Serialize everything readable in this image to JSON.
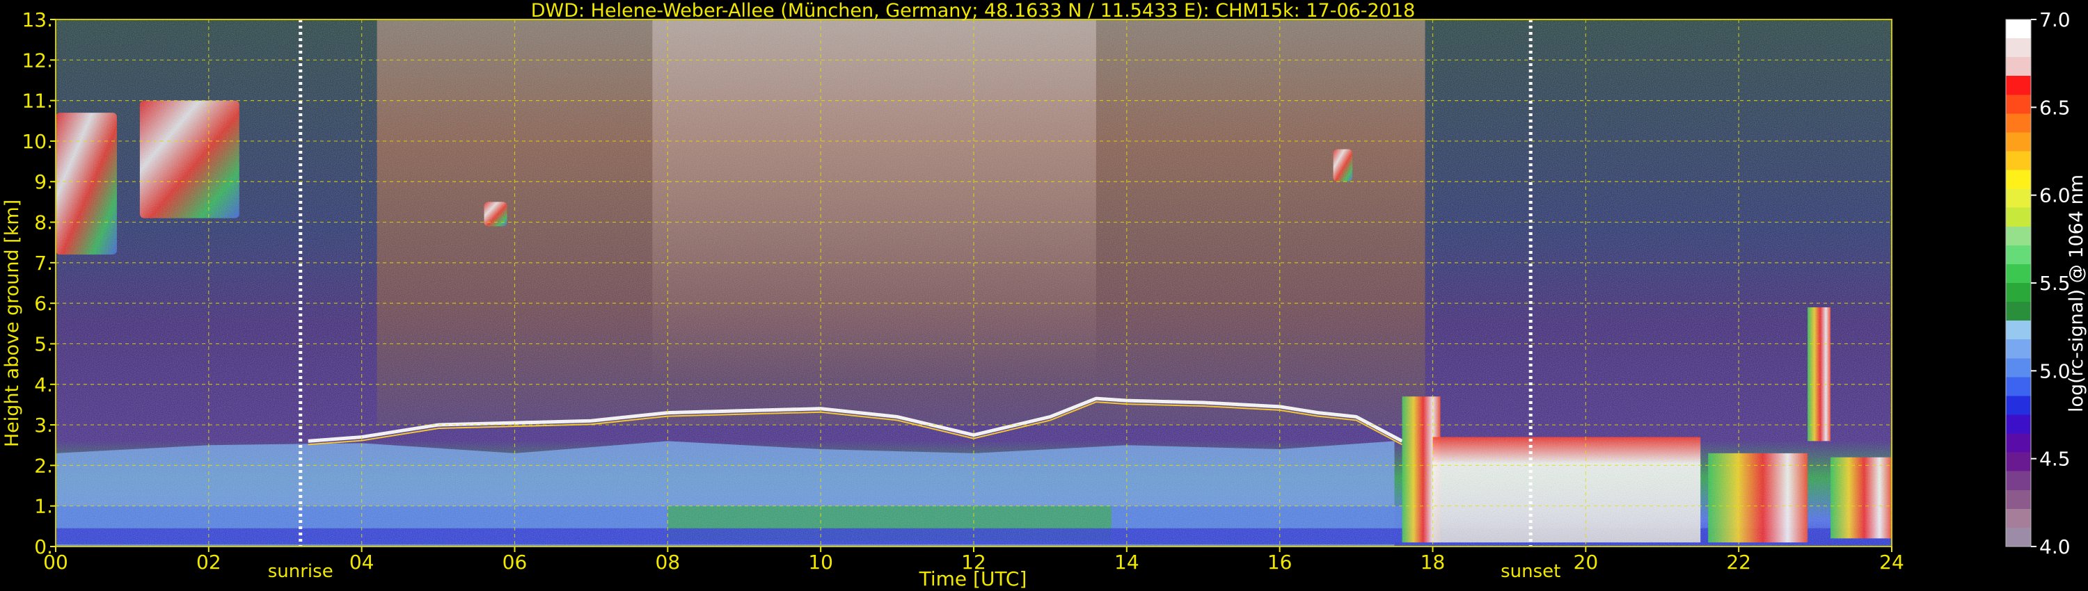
{
  "chart_data": {
    "type": "heatmap",
    "title": "DWD: Helene-Weber-Allee (München, Germany; 48.1633 N / 11.5433 E):    CHM15k: 17-06-2018",
    "xlabel": "Time [UTC]",
    "ylabel": "Height above ground [km]",
    "xlim": [
      0,
      24
    ],
    "ylim": [
      0,
      13
    ],
    "x_ticks": [
      {
        "value": 0,
        "label": "00"
      },
      {
        "value": 2,
        "label": "02"
      },
      {
        "value": 4,
        "label": "04"
      },
      {
        "value": 6,
        "label": "06"
      },
      {
        "value": 8,
        "label": "08"
      },
      {
        "value": 10,
        "label": "10"
      },
      {
        "value": 12,
        "label": "12"
      },
      {
        "value": 14,
        "label": "14"
      },
      {
        "value": 16,
        "label": "16"
      },
      {
        "value": 18,
        "label": "18"
      },
      {
        "value": 20,
        "label": "20"
      },
      {
        "value": 22,
        "label": "22"
      },
      {
        "value": 24,
        "label": "24"
      }
    ],
    "y_ticks": [
      {
        "value": 0,
        "label": "0."
      },
      {
        "value": 1,
        "label": "1."
      },
      {
        "value": 2,
        "label": "2."
      },
      {
        "value": 3,
        "label": "3."
      },
      {
        "value": 4,
        "label": "4."
      },
      {
        "value": 5,
        "label": "5."
      },
      {
        "value": 6,
        "label": "6."
      },
      {
        "value": 7,
        "label": "7."
      },
      {
        "value": 8,
        "label": "8."
      },
      {
        "value": 9,
        "label": "9."
      },
      {
        "value": 10,
        "label": "10."
      },
      {
        "value": 11,
        "label": "11."
      },
      {
        "value": 12,
        "label": "12."
      },
      {
        "value": 13,
        "label": "13."
      }
    ],
    "grid": true,
    "markers": [
      {
        "label": "sunrise",
        "time": 3.2
      },
      {
        "label": "sunset",
        "time": 19.28
      }
    ],
    "colorbar": {
      "label": "log(rc-signal) @ 1064 nm",
      "range": [
        4.0,
        7.0
      ],
      "ticks": [
        "4.0",
        "4.5",
        "5.0",
        "5.5",
        "6.0",
        "6.5",
        "7.0"
      ],
      "colors": [
        "#9c8ca8",
        "#a67e99",
        "#8c5b8c",
        "#7a3f8c",
        "#6a1a90",
        "#5a0ca8",
        "#3c0fc8",
        "#2430e0",
        "#3c64f0",
        "#5a8cf0",
        "#7aa8f0",
        "#96c8f0",
        "#2a8f3a",
        "#2aa83a",
        "#3cc850",
        "#66dc78",
        "#96e08c",
        "#c8e83c",
        "#e8f03c",
        "#fff01a",
        "#ffc81a",
        "#ffa01a",
        "#ff781a",
        "#ff4a1a",
        "#ff1a1a",
        "#f0c8c8",
        "#f0e0e0",
        "#ffffff"
      ]
    },
    "cloud_base_height_km": [
      {
        "time": 3.3,
        "height": 2.6
      },
      {
        "time": 4.0,
        "height": 2.7
      },
      {
        "time": 5.0,
        "height": 3.0
      },
      {
        "time": 6.0,
        "height": 3.05
      },
      {
        "time": 7.0,
        "height": 3.1
      },
      {
        "time": 8.0,
        "height": 3.3
      },
      {
        "time": 9.0,
        "height": 3.35
      },
      {
        "time": 10.0,
        "height": 3.4
      },
      {
        "time": 11.0,
        "height": 3.2
      },
      {
        "time": 12.0,
        "height": 2.75
      },
      {
        "time": 13.0,
        "height": 3.2
      },
      {
        "time": 13.6,
        "height": 3.65
      },
      {
        "time": 14.0,
        "height": 3.6
      },
      {
        "time": 15.0,
        "height": 3.55
      },
      {
        "time": 16.0,
        "height": 3.45
      },
      {
        "time": 16.5,
        "height": 3.3
      },
      {
        "time": 17.0,
        "height": 3.2
      },
      {
        "time": 17.6,
        "height": 2.6
      }
    ],
    "aerosol_layer_top_km": [
      {
        "time": 0,
        "height": 2.3
      },
      {
        "time": 2,
        "height": 2.5
      },
      {
        "time": 4,
        "height": 2.55
      },
      {
        "time": 6,
        "height": 2.3
      },
      {
        "time": 8,
        "height": 2.6
      },
      {
        "time": 10,
        "height": 2.4
      },
      {
        "time": 12,
        "height": 2.3
      },
      {
        "time": 14,
        "height": 2.5
      },
      {
        "time": 16,
        "height": 2.4
      },
      {
        "time": 17.5,
        "height": 2.6
      }
    ],
    "ice_clouds": [
      {
        "t0": 0.0,
        "t1": 0.8,
        "h0": 7.2,
        "h1": 10.7
      },
      {
        "t0": 1.1,
        "t1": 2.4,
        "h0": 8.1,
        "h1": 11.0
      },
      {
        "t0": 5.6,
        "t1": 5.9,
        "h0": 7.9,
        "h1": 8.5
      },
      {
        "t0": 16.7,
        "t1": 16.95,
        "h0": 9.0,
        "h1": 9.8
      }
    ],
    "low_clouds": [
      {
        "t0": 17.6,
        "t1": 18.1,
        "h0": 0.1,
        "h1": 3.7
      },
      {
        "t0": 18.0,
        "t1": 21.5,
        "h0": 0.1,
        "h1": 2.7
      },
      {
        "t0": 21.6,
        "t1": 22.9,
        "h0": 0.1,
        "h1": 2.3
      },
      {
        "t0": 22.9,
        "t1": 23.2,
        "h0": 2.6,
        "h1": 5.9
      },
      {
        "t0": 23.2,
        "t1": 24.0,
        "h0": 0.2,
        "h1": 2.2
      }
    ]
  }
}
